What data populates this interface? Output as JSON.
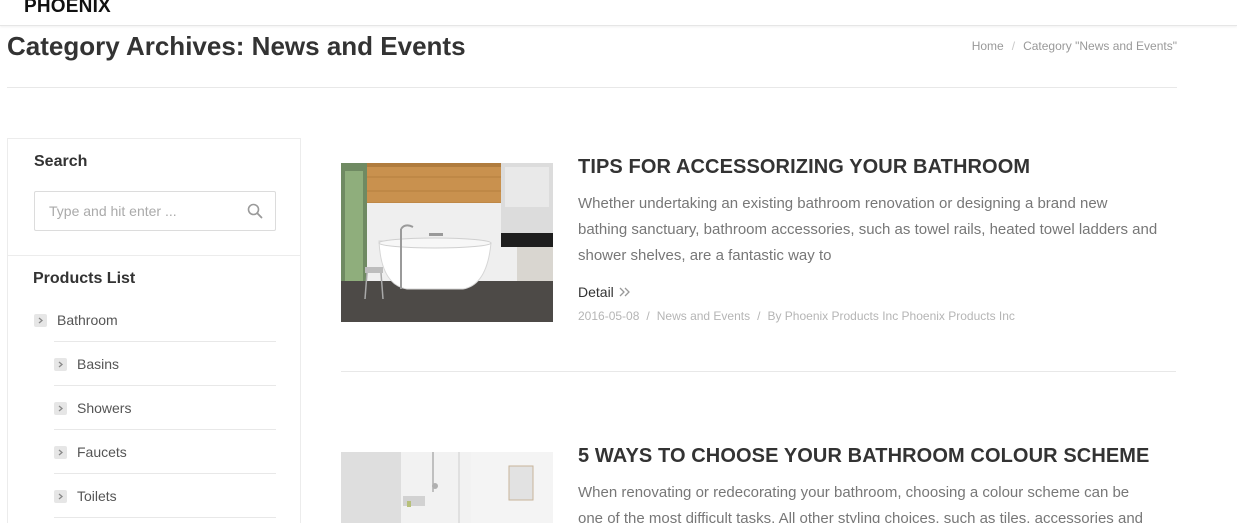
{
  "header": {
    "logo_text": "PHOENIX"
  },
  "page": {
    "title": "Category Archives: News and Events",
    "breadcrumb": {
      "home": "Home",
      "separator": "/",
      "current": "Category \"News and Events\""
    }
  },
  "sidebar": {
    "search": {
      "title": "Search",
      "placeholder": "Type and hit enter ...",
      "value": ""
    },
    "products": {
      "title": "Products List",
      "items": [
        {
          "label": "Bathroom"
        },
        {
          "label": "Basins"
        },
        {
          "label": "Showers"
        },
        {
          "label": "Faucets"
        },
        {
          "label": "Toilets"
        }
      ]
    }
  },
  "posts": [
    {
      "title": "TIPS FOR ACCESSORIZING YOUR BATHROOM",
      "excerpt": "Whether undertaking an existing bathroom renovation or designing a brand new bathing sanctuary, bathroom accessories, such as towel rails, heated towel ladders and shower shelves, are a fantastic way to",
      "detail_label": "Detail",
      "date": "2016-05-08",
      "meta_sep": "/",
      "category": "News and Events",
      "author": "By Phoenix Products Inc Phoenix Products Inc"
    },
    {
      "title": "5 WAYS TO CHOOSE YOUR BATHROOM COLOUR SCHEME",
      "excerpt": "When renovating or redecorating your bathroom, choosing a colour scheme can be one of the most difficult tasks. All other styling choices, such as tiles, accessories and"
    }
  ],
  "colors": {
    "text_dark": "#333333",
    "text_muted": "#777777",
    "meta": "#b5b5b5",
    "border": "#e8e8e8"
  }
}
